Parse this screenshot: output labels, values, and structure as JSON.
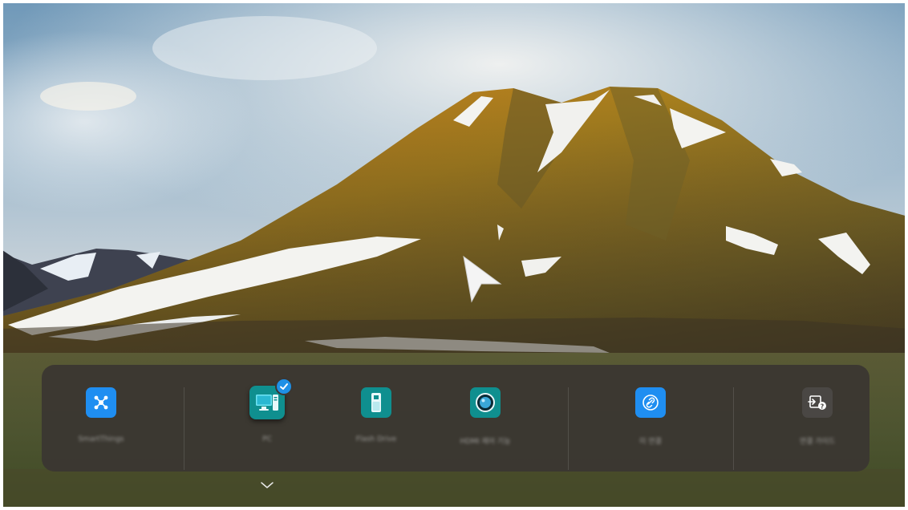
{
  "sources": [
    {
      "label": "SmartThings",
      "icon": "smartthings-icon",
      "color": "#1f8ef1",
      "selected": false
    },
    {
      "label": "PC",
      "icon": "pc-monitor-icon",
      "color": "#0f8f8f",
      "selected": true
    },
    {
      "label": "Flash Drive",
      "icon": "usb-drive-icon",
      "color": "#0f8f8f",
      "selected": false
    },
    {
      "label": "HDMI 제어 기능",
      "icon": "hdmi-camera-icon",
      "color": "#0f8f8f",
      "selected": false
    },
    {
      "label": "미 연결",
      "icon": "link-icon",
      "color": "#1f8ef1",
      "selected": false
    },
    {
      "label": "연결 가이드",
      "icon": "connection-guide-icon",
      "color": "#4a4744",
      "selected": false
    }
  ],
  "colors": {
    "tray": "#3a3632",
    "check": "#1e90e6"
  }
}
